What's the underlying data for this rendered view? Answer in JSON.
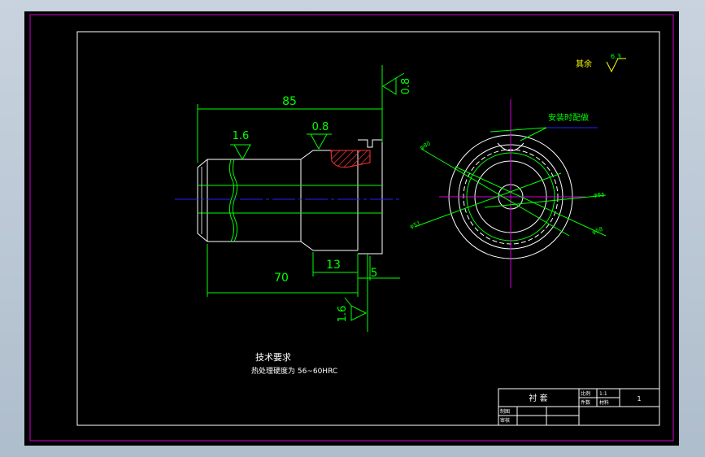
{
  "drawing": {
    "dimensions": {
      "overall_length": "85",
      "body_length": "70",
      "step_length": "13",
      "flange_width": "5"
    },
    "roughness": {
      "right_face": "0.8",
      "body": "1.6",
      "step": "0.8",
      "flange_bottom": "1.6",
      "other_value": "6.3"
    },
    "side_view": {
      "note": "安装时配做",
      "d_outer": "φ80",
      "d_65": "φ65",
      "d_58": "φ58",
      "d_51": "φ51"
    },
    "notes": {
      "roughness_other_label": "其余",
      "tech_title": "技术要求",
      "tech_text": "热处理硬度为 56~60HRC"
    },
    "title_block": {
      "name": "衬  套",
      "scale": "1:1",
      "qty": "1",
      "labels": [
        "比例",
        "件数",
        "材料",
        "重量",
        "制图",
        "审核"
      ]
    }
  },
  "colors": {
    "background": "#000000",
    "outline": "#ffffff",
    "dimension": "#00ff00",
    "centerline": "#2222ff",
    "border": "#d400d4",
    "hatch": "#ff3333",
    "roughness_other": "#ffff00"
  }
}
